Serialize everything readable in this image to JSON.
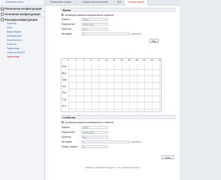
{
  "sidebar": {
    "top_sub": "Основные настр.",
    "sections": [
      {
        "label": "Локальная конфигурация",
        "expanded": false
      },
      {
        "label": "Основная конфигурация",
        "expanded": false
      },
      {
        "label": "Расшир.конфигурация",
        "expanded": true
      }
    ],
    "items": [
      {
        "label": "Система",
        "active": false
      },
      {
        "label": "Сеть",
        "active": false
      },
      {
        "label": "Видео/Аудио",
        "active": false
      },
      {
        "label": "Изображение",
        "active": false
      },
      {
        "label": "Безопасность",
        "active": false
      },
      {
        "label": "События",
        "active": false
      },
      {
        "label": "Хранилище",
        "active": false
      },
      {
        "label": "События SMART",
        "active": false
      },
      {
        "label": "Хранилище",
        "active": true
      }
    ]
  },
  "tabs": [
    {
      "label": "Расписание записи",
      "active": false
    },
    {
      "label": "Управление хранением",
      "active": false
    },
    {
      "label": "NAS",
      "active": false
    },
    {
      "label": "Снимок экрана",
      "active": true
    }
  ],
  "schedule_panel": {
    "title": "Время",
    "checkbox_label": "Активация захвата изображения по времени",
    "rows": [
      {
        "label": "Формат",
        "value": "JPEG",
        "unit": ""
      },
      {
        "label": "Разрешение",
        "value": "1920*1080",
        "unit": ""
      },
      {
        "label": "Качество",
        "value": "Выс.",
        "unit": ""
      },
      {
        "label": "Интервал",
        "value": "0",
        "unit": "миллисек."
      }
    ],
    "edit_button": "Ред."
  },
  "schedule_grid": {
    "hours": [
      "0",
      "2",
      "4",
      "6",
      "8",
      "10",
      "12",
      "14",
      "16",
      "18",
      "20",
      "22",
      "24"
    ],
    "days": [
      {
        "label": "Пон",
        "weekend": false
      },
      {
        "label": "Втр",
        "weekend": false
      },
      {
        "label": "Срд",
        "weekend": false
      },
      {
        "label": "Чет",
        "weekend": false
      },
      {
        "label": "Пят",
        "weekend": false
      },
      {
        "label": "Суб",
        "weekend": true
      },
      {
        "label": "Вск",
        "weekend": true
      }
    ]
  },
  "event_panel": {
    "title": "Особытие",
    "checkbox_label": "Активация захвата изображения по событию",
    "rows": [
      {
        "label": "Формат",
        "value": "JPEG",
        "unit": ""
      },
      {
        "label": "Разрешение",
        "value": "1920*1080",
        "unit": ""
      },
      {
        "label": "Качество",
        "value": "Выс.",
        "unit": ""
      },
      {
        "label": "Интервал",
        "value": "0",
        "unit": "миллисек."
      },
      {
        "label": "Номер захвата",
        "value": "4",
        "unit": ""
      }
    ]
  },
  "save_button": "Сохр.",
  "footer": "©Hikvision Digital Technology Co., Ltd. All Rights Reserved.",
  "colors": {
    "accent": "#c0282d",
    "link": "#3a6fb5"
  }
}
